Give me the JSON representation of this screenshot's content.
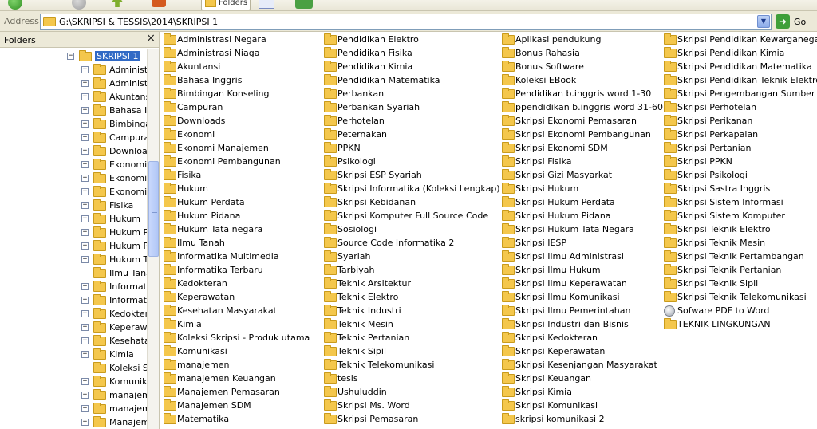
{
  "toolbar": {
    "back_label": "Back",
    "search_label": "Search",
    "folders_label": "Folders",
    "sync_label": "Folder Sync"
  },
  "address": {
    "label": "Address",
    "path": "G:\\SKRIPSI & TESSIS\\2014\\SKRIPSI 1",
    "go_label": "Go"
  },
  "folders_panel": {
    "title": "Folders",
    "close": "×",
    "tree": [
      {
        "label": "SKRIPSI 1",
        "expander": "−",
        "selected": true,
        "level": 0
      },
      {
        "label": "Administr",
        "expander": "+",
        "level": 1
      },
      {
        "label": "Administr",
        "expander": "+",
        "level": 1
      },
      {
        "label": "Akuntans",
        "expander": "+",
        "level": 1
      },
      {
        "label": "Bahasa Ir",
        "expander": "+",
        "level": 1
      },
      {
        "label": "Bimbingar",
        "expander": "+",
        "level": 1
      },
      {
        "label": "Campuran",
        "expander": "+",
        "level": 1
      },
      {
        "label": "Download",
        "expander": "+",
        "level": 1
      },
      {
        "label": "Ekonomi",
        "expander": "+",
        "level": 1
      },
      {
        "label": "Ekonomi M",
        "expander": "+",
        "level": 1
      },
      {
        "label": "Ekonomi P",
        "expander": "+",
        "level": 1
      },
      {
        "label": "Fisika",
        "expander": "+",
        "level": 1
      },
      {
        "label": "Hukum",
        "expander": "+",
        "level": 1
      },
      {
        "label": "Hukum Pe",
        "expander": "+",
        "level": 1
      },
      {
        "label": "Hukum Pic",
        "expander": "+",
        "level": 1
      },
      {
        "label": "Hukum Ta",
        "expander": "+",
        "level": 1
      },
      {
        "label": "Ilmu Tana",
        "expander": "",
        "level": 1
      },
      {
        "label": "Informatil",
        "expander": "+",
        "level": 1
      },
      {
        "label": "Informatil",
        "expander": "+",
        "level": 1
      },
      {
        "label": "Kedoktera",
        "expander": "+",
        "level": 1
      },
      {
        "label": "Keperawa",
        "expander": "+",
        "level": 1
      },
      {
        "label": "Kesehata",
        "expander": "+",
        "level": 1
      },
      {
        "label": "Kimia",
        "expander": "+",
        "level": 1
      },
      {
        "label": "Koleksi Sk",
        "expander": "",
        "level": 1
      },
      {
        "label": "Komunika",
        "expander": "+",
        "level": 1
      },
      {
        "label": "manajeme",
        "expander": "+",
        "level": 1
      },
      {
        "label": "manajeme",
        "expander": "+",
        "level": 1
      },
      {
        "label": "Manajeme",
        "expander": "+",
        "level": 1
      }
    ]
  },
  "files": {
    "columns": [
      [
        "Administrasi Negara",
        "Administrasi Niaga",
        "Akuntansi",
        "Bahasa Inggris",
        "Bimbingan Konseling",
        "Campuran",
        "Downloads",
        "Ekonomi",
        "Ekonomi Manajemen",
        "Ekonomi Pembangunan",
        "Fisika",
        "Hukum",
        "Hukum Perdata",
        "Hukum Pidana",
        "Hukum Tata negara",
        "Ilmu Tanah",
        "Informatika Multimedia",
        "Informatika Terbaru",
        "Kedokteran",
        "Keperawatan",
        "Kesehatan Masyarakat",
        "Kimia",
        "Koleksi Skripsi - Produk utama",
        "Komunikasi",
        "manajemen",
        "manajemen Keuangan",
        "Manajemen Pemasaran",
        "Manajemen SDM",
        "Matematika"
      ],
      [
        "Pendidikan Elektro",
        "Pendidikan Fisika",
        "Pendidikan Kimia",
        "Pendidikan Matematika",
        "Perbankan",
        "Perbankan Syariah",
        "Perhotelan",
        "Peternakan",
        "PPKN",
        "Psikologi",
        "Skripsi ESP Syariah",
        "Skripsi Informatika (Koleksi Lengkap)",
        "Skripsi Kebidanan",
        "Skripsi Komputer Full Source Code",
        "Sosiologi",
        "Source Code Informatika 2",
        "Syariah",
        "Tarbiyah",
        "Teknik Arsitektur",
        "Teknik Elektro",
        "Teknik Industri",
        "Teknik Mesin",
        "Teknik Pertanian",
        "Teknik Sipil",
        "Teknik Telekomunikasi",
        "tesis",
        "Ushuluddin",
        "Skripsi Ms. Word",
        "Skripsi Pemasaran"
      ],
      [
        "Aplikasi pendukung",
        "Bonus Rahasia",
        "Bonus Software",
        "Koleksi EBook",
        "Pendidikan b.inggris word 1-30",
        "ppendidikan b.inggris word 31-60",
        "Skripsi Ekonomi Pemasaran",
        "Skripsi Ekonomi Pembangunan",
        "Skripsi Ekonomi SDM",
        "Skripsi Fisika",
        "Skripsi Gizi Masyarkat",
        "Skripsi Hukum",
        "Skripsi Hukum Perdata",
        "Skripsi Hukum Pidana",
        "Skripsi Hukum Tata Negara",
        "Skripsi IESP",
        "Skripsi Ilmu Administrasi",
        "Skripsi Ilmu Hukum",
        "Skripsi Ilmu Keperawatan",
        "Skripsi Ilmu Komunikasi",
        "Skripsi Ilmu Pemerintahan",
        "Skripsi Industri dan Bisnis",
        "Skripsi Kedokteran",
        "Skripsi Keperawatan",
        "Skripsi Kesenjangan Masyarakat",
        "Skripsi Keuangan",
        "Skripsi Kimia",
        "Skripsi Komunikasi",
        "skripsi komunikasi 2"
      ],
      [
        "Skripsi Pendidikan Kewarganegaraan",
        "Skripsi Pendidikan Kimia",
        "Skripsi Pendidikan Matematika",
        "Skripsi Pendidikan Teknik Elektro",
        "Skripsi Pengembangan Sumber Daya",
        "Skripsi Perhotelan",
        "Skripsi Perikanan",
        "Skripsi Perkapalan",
        "Skripsi Pertanian",
        "Skripsi PPKN",
        "Skripsi Psikologi",
        "Skripsi Sastra Inggris",
        "Skripsi Sistem Informasi",
        "Skripsi Sistem Komputer",
        "Skripsi Teknik Elektro",
        "Skripsi Teknik Mesin",
        "Skripsi Teknik Pertambangan",
        "Skripsi Teknik Pertanian",
        "Skripsi Teknik Sipil",
        "Skripsi Teknik Telekomunikasi",
        "Sofware PDF to Word",
        "TEKNIK LINGKUNGAN"
      ]
    ]
  },
  "colors": {
    "selection": "#316ac5",
    "folder": "#f4c74c",
    "chrome": "#ece9d8"
  }
}
